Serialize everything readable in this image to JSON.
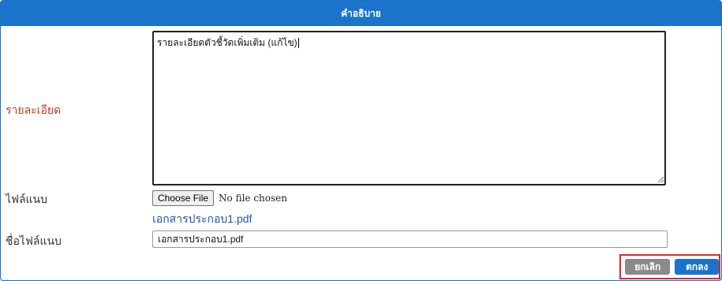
{
  "dialog": {
    "title": "คำอธิบาย"
  },
  "form": {
    "detail_label": "รายละเอียด",
    "detail_value": "รายละเอียดตัวชี้วัดเพิ่มเติม (แก้ไข)",
    "attachment_label": "ไฟล์แนบ",
    "choose_file_label": "Choose File",
    "no_file_text": "No file chosen",
    "attached_file_link": "เอกสารประกอบ1.pdf",
    "attachment_name_label": "ชื่อไฟล์แนบ",
    "attachment_name_value": "เอกสารประกอบ1.pdf"
  },
  "actions": {
    "cancel_label": "ยกเลิก",
    "ok_label": "ตกลง"
  },
  "colors": {
    "header": "#1a74c9",
    "detail_label": "#c0392b",
    "link": "#1a57a8",
    "highlight_border": "#e0242f",
    "cancel_button": "#8a8a8a",
    "ok_button": "#1a74c9"
  }
}
